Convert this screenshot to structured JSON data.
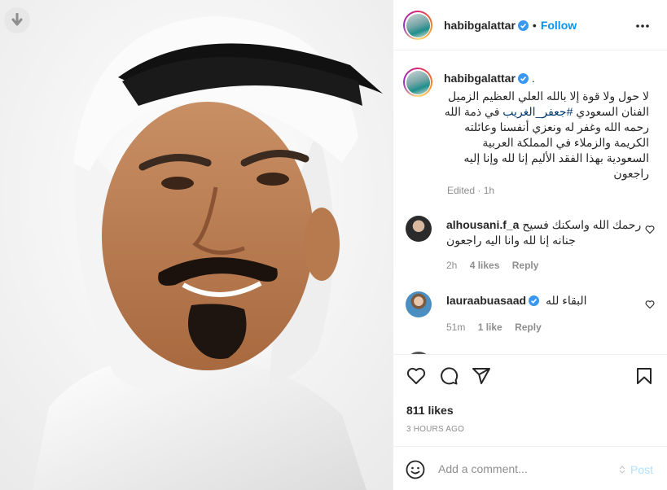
{
  "post": {
    "username": "habibgalattar",
    "follow_label": "Follow",
    "separator": "•",
    "caption_suffix": ".",
    "caption": "لا حول ولا قوة إلا بالله العلي العظيم الزميل الفنان السعودي",
    "hashtag": "#جعفر_الغريب",
    "caption_rest": "في ذمة الله رحمه الله وغفر له ونعزي أنفسنا وعائلته الكريمة والزملاء في المملكة العربية السعودية بهذا الفقد الأليم إنا لله وإنا إليه راجعون",
    "edited_label": "Edited",
    "edited_dot": "·",
    "edited_time": "1h"
  },
  "comments": [
    {
      "username": "alhousani.f_a",
      "text": "رحمك الله واسكنك فسيح جنانه إنا لله وانا اليه راجعون",
      "time": "2h",
      "likes": "4 likes",
      "reply": "Reply"
    },
    {
      "username": "lauraabuasaad",
      "text": "البقاء لله",
      "time": "51m",
      "likes": "1 like",
      "reply": "Reply"
    }
  ],
  "footer": {
    "likes": "811 likes",
    "time_ago": "3 HOURS AGO",
    "comment_placeholder": "Add a comment...",
    "post_label": "Post"
  },
  "colors": {
    "accent": "#0095f6",
    "verified": "#3897f0",
    "post_disabled": "#b2dffc"
  }
}
